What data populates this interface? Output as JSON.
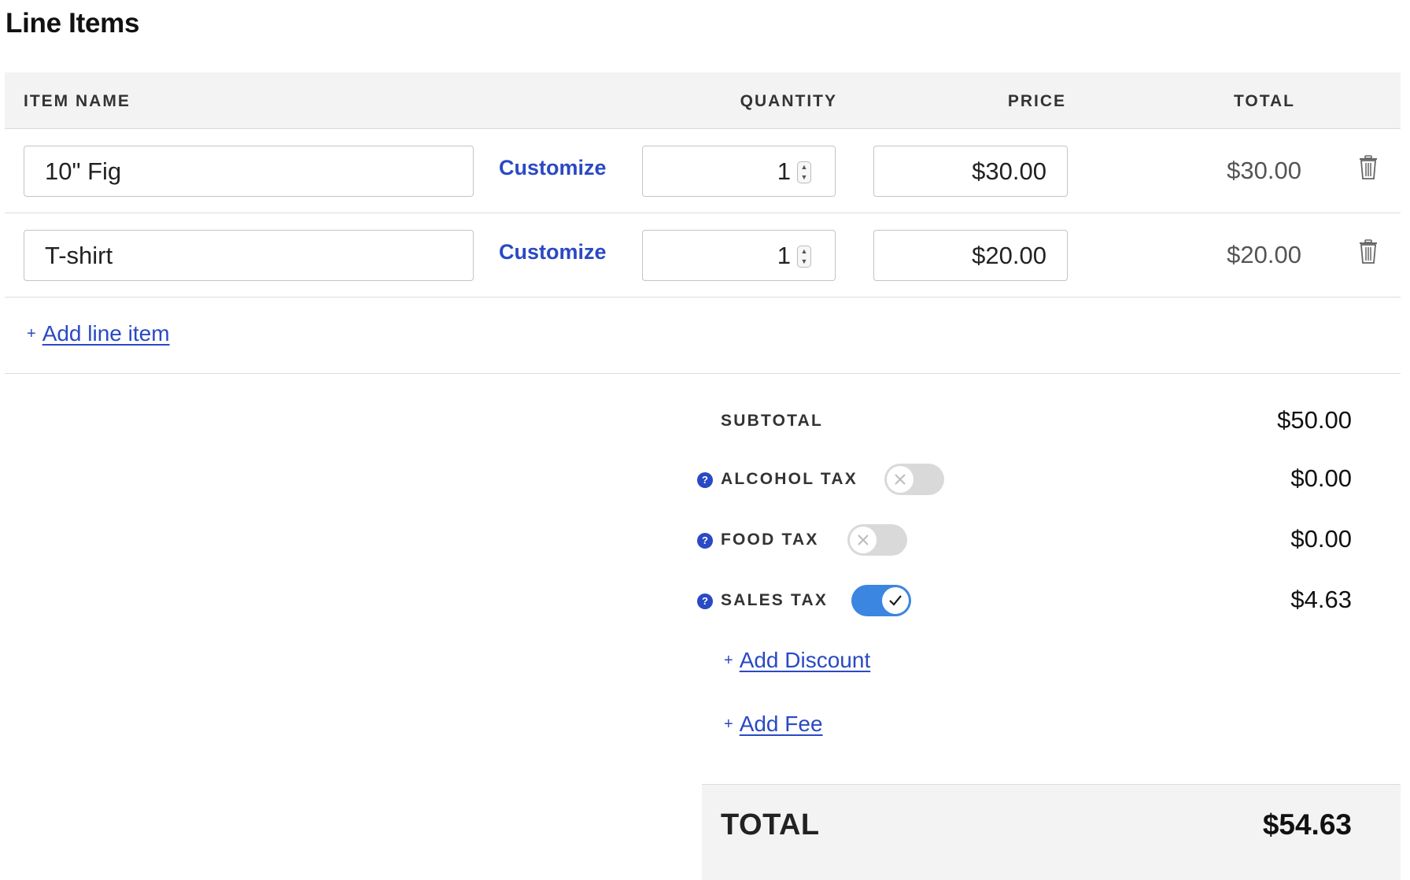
{
  "section": {
    "title": "Line Items"
  },
  "table": {
    "headers": {
      "item_name": "ITEM NAME",
      "quantity": "QUANTITY",
      "price": "PRICE",
      "total": "TOTAL"
    },
    "rows": [
      {
        "name": "10\" Fig",
        "customize_label": "Customize",
        "quantity": "1",
        "price": "$30.00",
        "total": "$30.00"
      },
      {
        "name": "T-shirt",
        "customize_label": "Customize",
        "quantity": "1",
        "price": "$20.00",
        "total": "$20.00"
      }
    ],
    "add_line_plus": "+",
    "add_line_label": "Add line item"
  },
  "summary": {
    "subtotal": {
      "label": "SUBTOTAL",
      "value": "$50.00"
    },
    "taxes": [
      {
        "label": "ALCOHOL TAX",
        "enabled": false,
        "value": "$0.00"
      },
      {
        "label": "FOOD TAX",
        "enabled": false,
        "value": "$0.00"
      },
      {
        "label": "SALES TAX",
        "enabled": true,
        "value": "$4.63"
      }
    ],
    "help_glyph": "?",
    "add_discount_plus": "+",
    "add_discount_label": "Add Discount",
    "add_fee_plus": "+",
    "add_fee_label": "Add Fee",
    "total": {
      "label": "TOTAL",
      "value": "$54.63"
    }
  },
  "colors": {
    "accent": "#2a49c4",
    "toggle_on": "#3a86e0",
    "toggle_off": "#d9d9d9",
    "header_bg": "#f3f3f3"
  },
  "icons": {
    "trash": "trash-icon",
    "help": "help-icon",
    "spinner": "spinner-icon",
    "check": "check-icon",
    "x": "x-icon"
  }
}
